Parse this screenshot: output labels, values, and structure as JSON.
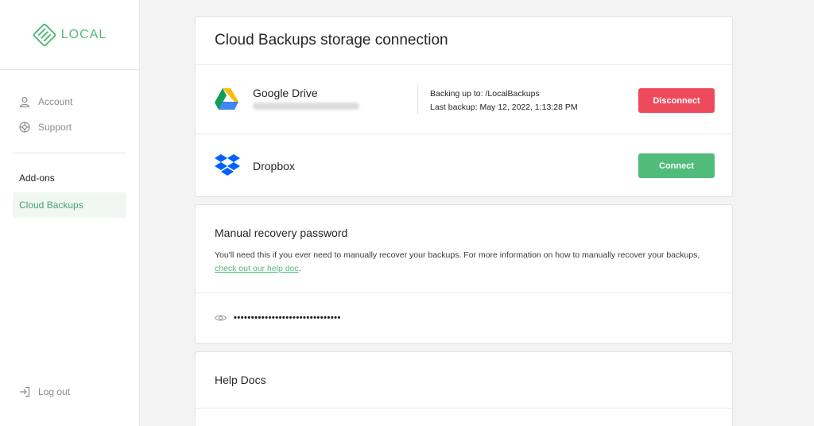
{
  "app": {
    "logo_text": "LOCAL",
    "brand_color": "#51bb7b"
  },
  "sidebar": {
    "items": [
      {
        "label": "Account",
        "icon": "user-icon"
      },
      {
        "label": "Support",
        "icon": "support-icon"
      }
    ],
    "addons_heading": "Add-ons",
    "addons": [
      {
        "label": "Cloud Backups",
        "active": true
      }
    ],
    "logout_label": "Log out"
  },
  "storage": {
    "title": "Cloud Backups storage connection",
    "providers": [
      {
        "name": "Google Drive",
        "icon": "google-drive-icon",
        "backing_up_label": "Backing up to:",
        "backing_up_value": "/LocalBackups",
        "last_backup_label": "Last backup:",
        "last_backup_value": "May 12, 2022, 1:13:28 PM",
        "action_label": "Disconnect",
        "action_color": "#ed4b5c"
      },
      {
        "name": "Dropbox",
        "icon": "dropbox-icon",
        "action_label": "Connect",
        "action_color": "#51bb7b"
      }
    ]
  },
  "recovery": {
    "title": "Manual recovery password",
    "description": "You'll need this if you ever need to manually recover your backups. For more information on how to manually recover your backups,",
    "link_text": "check out our help doc",
    "after_link": ".",
    "password_masked": "•••••••••••••••••••••••••••••••"
  },
  "help": {
    "title": "Help Docs"
  }
}
